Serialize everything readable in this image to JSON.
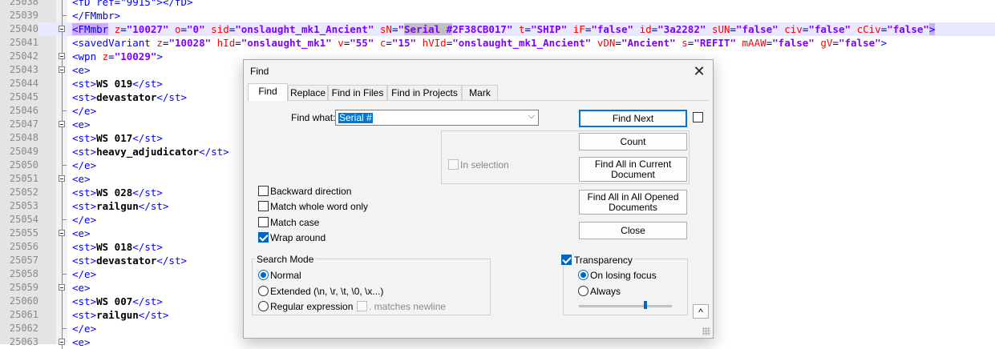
{
  "editor": {
    "lines": [
      {
        "num": "25038",
        "text": "<fD ref=\"9915\"></fD>",
        "fold": "bar"
      },
      {
        "num": "25039",
        "text": "</FMmbr>",
        "fold": "end"
      },
      {
        "num": "25040",
        "fold": "box",
        "highlight": true,
        "tokens": [
          {
            "t": "<FMmbr",
            "c": "t mb"
          },
          {
            "t": " ",
            "c": ""
          },
          {
            "t": "z",
            "c": "a"
          },
          {
            "t": "=",
            "c": ""
          },
          {
            "t": "\"10027\"",
            "c": "v"
          },
          {
            "t": " ",
            "c": ""
          },
          {
            "t": "o",
            "c": "a"
          },
          {
            "t": "=",
            "c": ""
          },
          {
            "t": "\"0\"",
            "c": "v"
          },
          {
            "t": " ",
            "c": ""
          },
          {
            "t": "sid",
            "c": "a"
          },
          {
            "t": "=",
            "c": ""
          },
          {
            "t": "\"onslaught_mk1_Ancient\"",
            "c": "v"
          },
          {
            "t": " ",
            "c": ""
          },
          {
            "t": "sN",
            "c": "a"
          },
          {
            "t": "=",
            "c": ""
          },
          {
            "t": "\"",
            "c": "v"
          },
          {
            "t": "Serial #",
            "c": "v sel"
          },
          {
            "t": "2F38CB017\"",
            "c": "v"
          },
          {
            "t": " ",
            "c": ""
          },
          {
            "t": "t",
            "c": "a"
          },
          {
            "t": "=",
            "c": ""
          },
          {
            "t": "\"SHIP\"",
            "c": "v"
          },
          {
            "t": " ",
            "c": ""
          },
          {
            "t": "iF",
            "c": "a"
          },
          {
            "t": "=",
            "c": ""
          },
          {
            "t": "\"false\"",
            "c": "v"
          },
          {
            "t": " ",
            "c": ""
          },
          {
            "t": "id",
            "c": "a"
          },
          {
            "t": "=",
            "c": ""
          },
          {
            "t": "\"3a2282\"",
            "c": "v"
          },
          {
            "t": " ",
            "c": ""
          },
          {
            "t": "sUN",
            "c": "a"
          },
          {
            "t": "=",
            "c": ""
          },
          {
            "t": "\"false\"",
            "c": "v"
          },
          {
            "t": " ",
            "c": ""
          },
          {
            "t": "civ",
            "c": "a"
          },
          {
            "t": "=",
            "c": ""
          },
          {
            "t": "\"false\"",
            "c": "v"
          },
          {
            "t": " ",
            "c": ""
          },
          {
            "t": "cCiv",
            "c": "a"
          },
          {
            "t": "=",
            "c": ""
          },
          {
            "t": "\"false\"",
            "c": "v"
          },
          {
            "t": ">",
            "c": "t mb"
          }
        ]
      },
      {
        "num": "25041",
        "fold": "bar",
        "tokens": [
          {
            "t": "<savedVariant",
            "c": "t"
          },
          {
            "t": " ",
            "c": ""
          },
          {
            "t": "z",
            "c": "a"
          },
          {
            "t": "=",
            "c": ""
          },
          {
            "t": "\"10028\"",
            "c": "v"
          },
          {
            "t": " ",
            "c": ""
          },
          {
            "t": "hId",
            "c": "a"
          },
          {
            "t": "=",
            "c": ""
          },
          {
            "t": "\"onslaught_mk1\"",
            "c": "v"
          },
          {
            "t": " ",
            "c": ""
          },
          {
            "t": "v",
            "c": "a"
          },
          {
            "t": "=",
            "c": ""
          },
          {
            "t": "\"55\"",
            "c": "v"
          },
          {
            "t": " ",
            "c": ""
          },
          {
            "t": "c",
            "c": "a"
          },
          {
            "t": "=",
            "c": ""
          },
          {
            "t": "\"15\"",
            "c": "v"
          },
          {
            "t": " ",
            "c": ""
          },
          {
            "t": "hVId",
            "c": "a"
          },
          {
            "t": "=",
            "c": ""
          },
          {
            "t": "\"onslaught_mk1_Ancient\"",
            "c": "v"
          },
          {
            "t": " ",
            "c": ""
          },
          {
            "t": "vDN",
            "c": "a"
          },
          {
            "t": "=",
            "c": ""
          },
          {
            "t": "\"Ancient\"",
            "c": "v"
          },
          {
            "t": " ",
            "c": ""
          },
          {
            "t": "s",
            "c": "a"
          },
          {
            "t": "=",
            "c": ""
          },
          {
            "t": "\"REFIT\"",
            "c": "v"
          },
          {
            "t": " ",
            "c": ""
          },
          {
            "t": "mAAW",
            "c": "a"
          },
          {
            "t": "=",
            "c": ""
          },
          {
            "t": "\"false\"",
            "c": "v"
          },
          {
            "t": " ",
            "c": ""
          },
          {
            "t": "gV",
            "c": "a"
          },
          {
            "t": "=",
            "c": ""
          },
          {
            "t": "\"false\"",
            "c": "v"
          },
          {
            "t": ">",
            "c": "t"
          }
        ]
      },
      {
        "num": "25042",
        "fold": "box",
        "tokens": [
          {
            "t": "<wpn",
            "c": "t"
          },
          {
            "t": " ",
            "c": ""
          },
          {
            "t": "z",
            "c": "a"
          },
          {
            "t": "=",
            "c": ""
          },
          {
            "t": "\"10029\"",
            "c": "v"
          },
          {
            "t": ">",
            "c": "t"
          }
        ]
      },
      {
        "num": "25043",
        "fold": "box",
        "tokens": [
          {
            "t": "<e>",
            "c": "t"
          }
        ]
      },
      {
        "num": "25044",
        "fold": "bar",
        "tokens": [
          {
            "t": "<st>",
            "c": "t"
          },
          {
            "t": "WS 019",
            "c": "tx"
          },
          {
            "t": "</st>",
            "c": "t"
          }
        ]
      },
      {
        "num": "25045",
        "fold": "bar",
        "tokens": [
          {
            "t": "<st>",
            "c": "t"
          },
          {
            "t": "devastator",
            "c": "tx"
          },
          {
            "t": "</st>",
            "c": "t"
          }
        ]
      },
      {
        "num": "25046",
        "fold": "end",
        "tokens": [
          {
            "t": "</e>",
            "c": "t"
          }
        ]
      },
      {
        "num": "25047",
        "fold": "box",
        "tokens": [
          {
            "t": "<e>",
            "c": "t"
          }
        ]
      },
      {
        "num": "25048",
        "fold": "bar",
        "tokens": [
          {
            "t": "<st>",
            "c": "t"
          },
          {
            "t": "WS 017",
            "c": "tx"
          },
          {
            "t": "</st>",
            "c": "t"
          }
        ]
      },
      {
        "num": "25049",
        "fold": "bar",
        "tokens": [
          {
            "t": "<st>",
            "c": "t"
          },
          {
            "t": "heavy_adjudicator",
            "c": "tx"
          },
          {
            "t": "</st>",
            "c": "t"
          }
        ]
      },
      {
        "num": "25050",
        "fold": "end",
        "tokens": [
          {
            "t": "</e>",
            "c": "t"
          }
        ]
      },
      {
        "num": "25051",
        "fold": "box",
        "tokens": [
          {
            "t": "<e>",
            "c": "t"
          }
        ]
      },
      {
        "num": "25052",
        "fold": "bar",
        "tokens": [
          {
            "t": "<st>",
            "c": "t"
          },
          {
            "t": "WS 028",
            "c": "tx"
          },
          {
            "t": "</st>",
            "c": "t"
          }
        ]
      },
      {
        "num": "25053",
        "fold": "bar",
        "tokens": [
          {
            "t": "<st>",
            "c": "t"
          },
          {
            "t": "railgun",
            "c": "tx"
          },
          {
            "t": "</st>",
            "c": "t"
          }
        ]
      },
      {
        "num": "25054",
        "fold": "end",
        "tokens": [
          {
            "t": "</e>",
            "c": "t"
          }
        ]
      },
      {
        "num": "25055",
        "fold": "box",
        "tokens": [
          {
            "t": "<e>",
            "c": "t"
          }
        ]
      },
      {
        "num": "25056",
        "fold": "bar",
        "tokens": [
          {
            "t": "<st>",
            "c": "t"
          },
          {
            "t": "WS 018",
            "c": "tx"
          },
          {
            "t": "</st>",
            "c": "t"
          }
        ]
      },
      {
        "num": "25057",
        "fold": "bar",
        "tokens": [
          {
            "t": "<st>",
            "c": "t"
          },
          {
            "t": "devastator",
            "c": "tx"
          },
          {
            "t": "</st>",
            "c": "t"
          }
        ]
      },
      {
        "num": "25058",
        "fold": "end",
        "tokens": [
          {
            "t": "</e>",
            "c": "t"
          }
        ]
      },
      {
        "num": "25059",
        "fold": "box",
        "tokens": [
          {
            "t": "<e>",
            "c": "t"
          }
        ]
      },
      {
        "num": "25060",
        "fold": "bar",
        "tokens": [
          {
            "t": "<st>",
            "c": "t"
          },
          {
            "t": "WS 007",
            "c": "tx"
          },
          {
            "t": "</st>",
            "c": "t"
          }
        ]
      },
      {
        "num": "25061",
        "fold": "bar",
        "tokens": [
          {
            "t": "<st>",
            "c": "t"
          },
          {
            "t": "railgun",
            "c": "tx"
          },
          {
            "t": "</st>",
            "c": "t"
          }
        ]
      },
      {
        "num": "25062",
        "fold": "end",
        "tokens": [
          {
            "t": "</e>",
            "c": "t"
          }
        ]
      },
      {
        "num": "25063",
        "fold": "box",
        "tokens": [
          {
            "t": "<e>",
            "c": "t"
          }
        ]
      }
    ]
  },
  "dialog": {
    "title": "Find",
    "close_glyph": "✕",
    "tabs": [
      "Find",
      "Replace",
      "Find in Files",
      "Find in Projects",
      "Mark"
    ],
    "find_what_label": "Find what:",
    "find_what_value": "Serial #",
    "dropdown_glyph": "⌵",
    "buttons": {
      "find_next": "Find Next",
      "count": "Count",
      "find_all_current": "Find All in Current Document",
      "find_all_opened": "Find All in All Opened Documents",
      "close": "Close"
    },
    "in_selection": "In selection",
    "options": [
      {
        "label": "Backward direction",
        "checked": false
      },
      {
        "label": "Match whole word only",
        "checked": false
      },
      {
        "label": "Match case",
        "checked": false
      },
      {
        "label": "Wrap around",
        "checked": true
      }
    ],
    "search_mode": {
      "label": "Search Mode",
      "normal": "Normal",
      "extended": "Extended (\\n, \\r, \\t, \\0, \\x...)",
      "regex": "Regular expression",
      "matches_newline": ". matches newline",
      "selected": "Normal"
    },
    "transparency": {
      "label": "Transparency",
      "checked": true,
      "on_losing_focus": "On losing focus",
      "always": "Always",
      "selected": "On losing focus",
      "level": 0.72
    },
    "expand_glyph": "^"
  }
}
